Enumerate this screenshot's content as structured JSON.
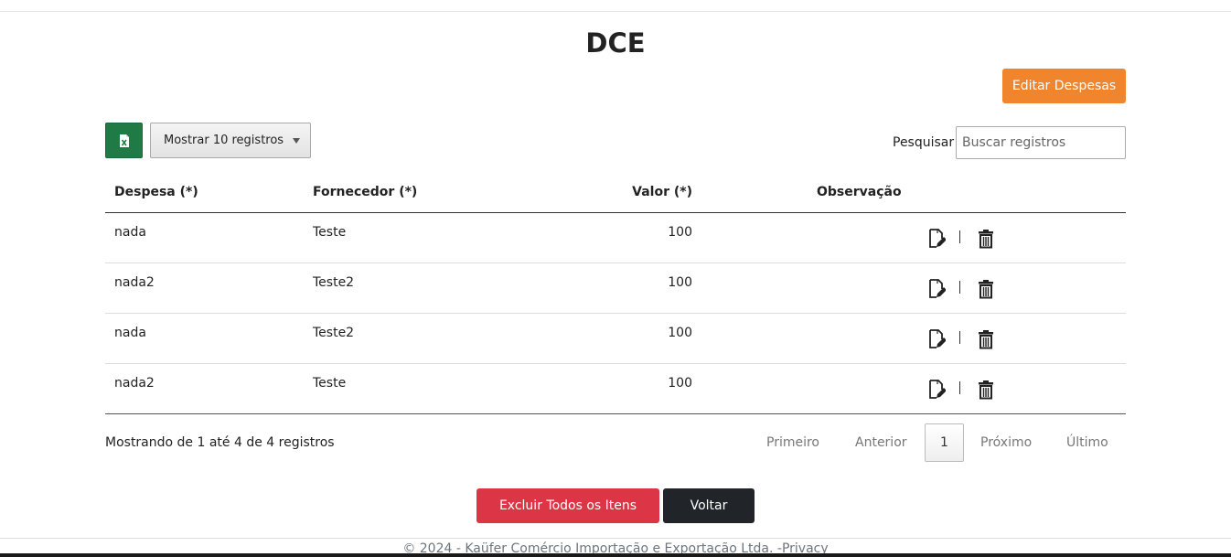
{
  "page": {
    "title": "DCE"
  },
  "toolbar": {
    "edit_label": "Editar Despesas",
    "excel_icon": "excel-export-icon",
    "length_label": "Mostrar 10 registros",
    "search_label": "Pesquisar",
    "search_placeholder": "Buscar registros"
  },
  "table": {
    "headers": {
      "despesa": "Despesa (*)",
      "fornecedor": "Fornecedor (*)",
      "valor": "Valor (*)",
      "observacao": "Observação"
    },
    "rows": [
      {
        "despesa": "nada",
        "fornecedor": "Teste",
        "valor": "100",
        "observacao": ""
      },
      {
        "despesa": "nada2",
        "fornecedor": "Teste2",
        "valor": "100",
        "observacao": ""
      },
      {
        "despesa": "nada",
        "fornecedor": "Teste2",
        "valor": "100",
        "observacao": ""
      },
      {
        "despesa": "nada2",
        "fornecedor": "Teste",
        "valor": "100",
        "observacao": ""
      }
    ],
    "row_actions": {
      "separator": "|",
      "edit_icon": "edit-document-icon",
      "delete_icon": "trash-icon"
    }
  },
  "pagination": {
    "info": "Mostrando de 1 até 4 de 4 registros",
    "first": "Primeiro",
    "previous": "Anterior",
    "current": "1",
    "next": "Próximo",
    "last": "Último"
  },
  "actions": {
    "delete_all": "Excluir Todos os Itens",
    "back": "Voltar"
  },
  "footer": {
    "text": "© 2024 - Kaüfer Comércio Importação e Exportação Ltda. -",
    "privacy": "Privacy"
  },
  "colors": {
    "edit_button": "#f0852d",
    "excel_button": "#1f7a45",
    "danger": "#dc3545",
    "dark": "#212529"
  }
}
